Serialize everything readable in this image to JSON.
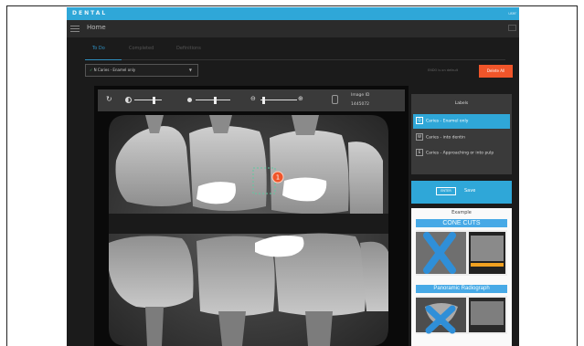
{
  "app": {
    "brand": "DENTAL",
    "topbar_right": "user",
    "nav_title": "Home"
  },
  "tabs": [
    {
      "label": "To Do"
    },
    {
      "label": "Completed"
    },
    {
      "label": "Definitions"
    }
  ],
  "filter": {
    "selected": "N Caries - Enamel only",
    "check": "✓",
    "caret": "▼"
  },
  "status_text": "ENDO is on default",
  "delete_button": "Delete All",
  "toolbar": {
    "image_id_label": "Image ID",
    "image_id_value": "1445072",
    "rotate_icon": "↻",
    "zoom_icon": "🔍"
  },
  "labels_panel": {
    "title": "Labels",
    "items": [
      {
        "key": "Q",
        "label": "Caries - Enamel only",
        "active": true
      },
      {
        "key": "W",
        "label": "Caries - into dentin",
        "active": false
      },
      {
        "key": "E",
        "label": "Caries - Approaching or into pulp",
        "active": false
      }
    ]
  },
  "save_bar": {
    "key": "ENTER",
    "label": "Save"
  },
  "example": {
    "title": "Example",
    "banner1": "CONE CUTS",
    "banner2": "Panoramic Radiograph"
  },
  "annotation": {
    "marker_number": "1"
  },
  "colors": {
    "accent": "#2fa7d8",
    "danger": "#f0552a",
    "marker": "#f0552a"
  }
}
